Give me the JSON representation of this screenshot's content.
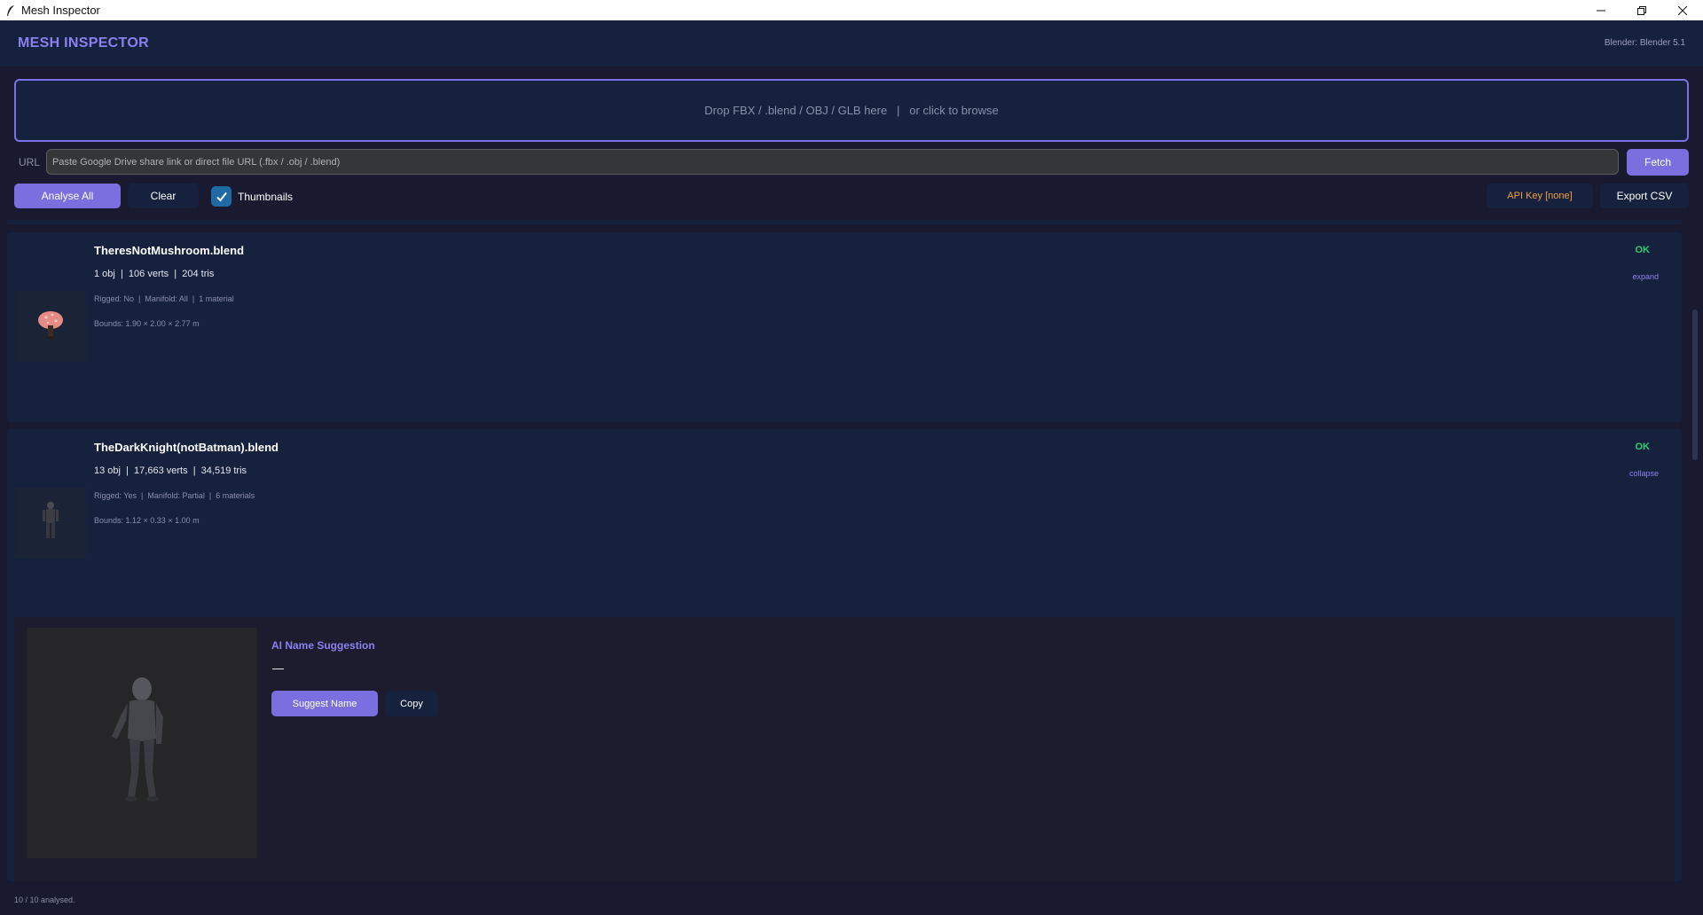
{
  "window": {
    "title": "Mesh Inspector"
  },
  "header": {
    "brand": "MESH INSPECTOR",
    "blender_version": "Blender: Blender 5.1"
  },
  "dropzone": {
    "label": "Drop FBX / .blend / OBJ / GLB here   |   or click to browse"
  },
  "url_row": {
    "label": "URL",
    "placeholder": "Paste Google Drive share link or direct file URL (.fbx / .obj / .blend)",
    "fetch_label": "Fetch"
  },
  "actions": {
    "analyse_label": "Analyse All",
    "clear_label": "Clear",
    "thumbnails_label": "Thumbnails",
    "thumbnails_checked": true,
    "api_key_label": "API Key [none]",
    "export_label": "Export CSV"
  },
  "files": [
    {
      "name": "TheresNotMushroom.blend",
      "stats": "1 obj  |  106 verts  |  204 tris",
      "details": "Rigged: No  |  Manifold: All  |  1 material",
      "bounds": "Bounds: 1.90 × 2.00 × 2.77 m",
      "status": "OK",
      "toggle": "expand",
      "thumbnail_icon": "mushroom-icon"
    },
    {
      "name": "TheDarkKnight(notBatman).blend",
      "stats": "13 obj  |  17,663 verts  |  34,519 tris",
      "details": "Rigged: Yes  |  Manifold: Partial  |  6 materials",
      "bounds": "Bounds: 1.12 × 0.33 × 1.00 m",
      "status": "OK",
      "toggle": "collapse",
      "thumbnail_icon": "knight-figure-icon",
      "expanded": {
        "ai_title": "AI Name Suggestion",
        "ai_value": "—",
        "suggest_label": "Suggest Name",
        "copy_label": "Copy"
      }
    }
  ],
  "status": "10 / 10 analysed.",
  "colors": {
    "accent": "#7b6fe0",
    "panel": "#16213e",
    "background": "#19192f",
    "ok": "#2ecc71",
    "warning": "#f0a040"
  }
}
